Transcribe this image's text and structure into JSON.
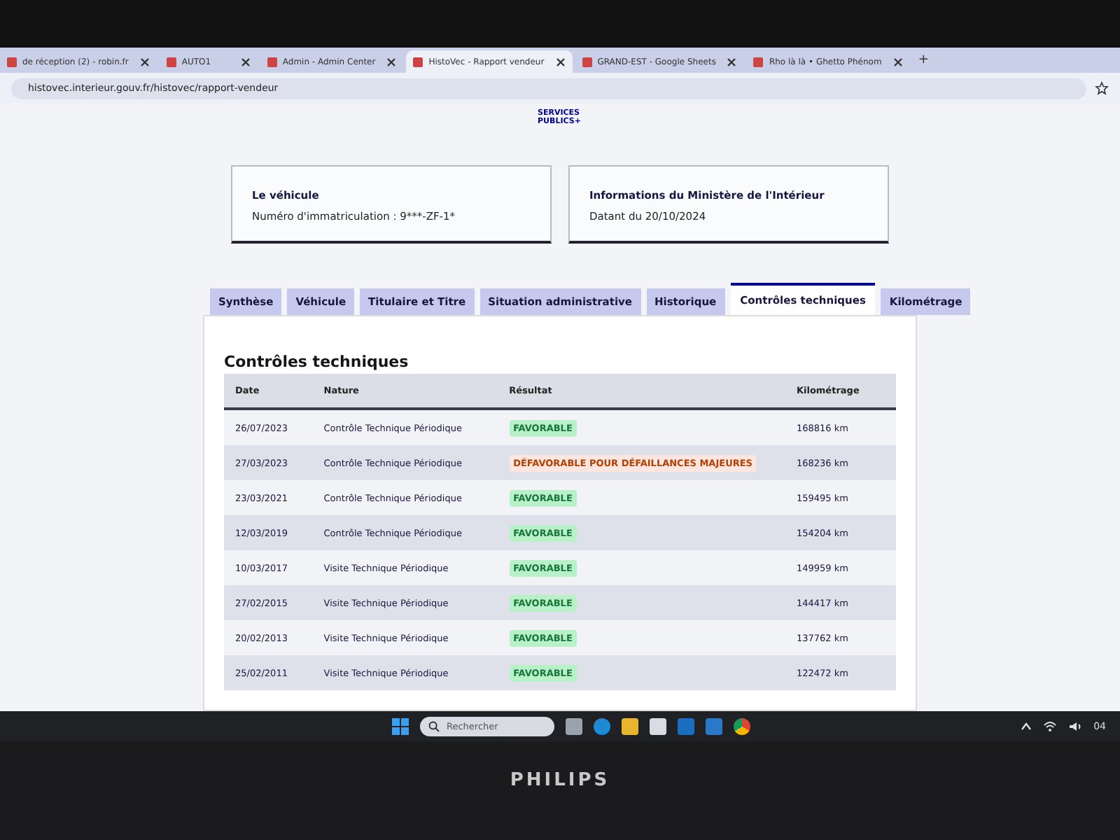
{
  "browser": {
    "tabs": [
      {
        "title": "de réception (2) - robin.fr",
        "selected": false
      },
      {
        "title": "AUTO1",
        "selected": false
      },
      {
        "title": "Admin - Admin Center",
        "selected": false
      },
      {
        "title": "HistoVec - Rapport vendeur",
        "selected": true
      },
      {
        "title": "GRAND-EST - Google Sheets",
        "selected": false
      },
      {
        "title": "Rho là là • Ghetto Phénom",
        "selected": false
      }
    ],
    "new_tab": "+",
    "address": "histovec.interieur.gouv.fr/histovec/rapport-vendeur"
  },
  "header": {
    "logo": "SERVICES PUBLICS+"
  },
  "cards": [
    {
      "title": "Le véhicule",
      "text": "Numéro d'immatriculation : 9***-ZF-1*"
    },
    {
      "title": "Informations du Ministère de l'Intérieur",
      "text": "Datant du 20/10/2024"
    }
  ],
  "tabs": [
    {
      "label": "Synthèse",
      "selected": false
    },
    {
      "label": "Véhicule",
      "selected": false
    },
    {
      "label": "Titulaire et Titre",
      "selected": false
    },
    {
      "label": "Situation administrative",
      "selected": false
    },
    {
      "label": "Historique",
      "selected": false
    },
    {
      "label": "Contrôles techniques",
      "selected": true
    },
    {
      "label": "Kilométrage",
      "selected": false
    }
  ],
  "section_title": "Contrôles techniques",
  "table": {
    "columns": [
      "Date",
      "Nature",
      "Résultat",
      "Kilométrage"
    ],
    "rows": [
      {
        "date": "26/07/2023",
        "nature": "Contrôle Technique Périodique",
        "result": "FAVORABLE",
        "kind": "favorable",
        "km": "168816 km"
      },
      {
        "date": "27/03/2023",
        "nature": "Contrôle Technique Périodique",
        "result": "DÉFAVORABLE POUR DÉFAILLANCES MAJEURES",
        "kind": "unfavorable",
        "km": "168236 km"
      },
      {
        "date": "23/03/2021",
        "nature": "Contrôle Technique Périodique",
        "result": "FAVORABLE",
        "kind": "favorable",
        "km": "159495 km"
      },
      {
        "date": "12/03/2019",
        "nature": "Contrôle Technique Périodique",
        "result": "FAVORABLE",
        "kind": "favorable",
        "km": "154204 km"
      },
      {
        "date": "10/03/2017",
        "nature": "Visite Technique Périodique",
        "result": "FAVORABLE",
        "kind": "favorable",
        "km": "149959 km"
      },
      {
        "date": "27/02/2015",
        "nature": "Visite Technique Périodique",
        "result": "FAVORABLE",
        "kind": "favorable",
        "km": "144417 km"
      },
      {
        "date": "20/02/2013",
        "nature": "Visite Technique Périodique",
        "result": "FAVORABLE",
        "kind": "favorable",
        "km": "137762 km"
      },
      {
        "date": "25/02/2011",
        "nature": "Visite Technique Périodique",
        "result": "FAVORABLE",
        "kind": "favorable",
        "km": "122472 km"
      }
    ]
  },
  "taskbar": {
    "search_placeholder": "Rechercher",
    "clock": "04"
  },
  "monitor": {
    "brand": "PHILIPS"
  }
}
